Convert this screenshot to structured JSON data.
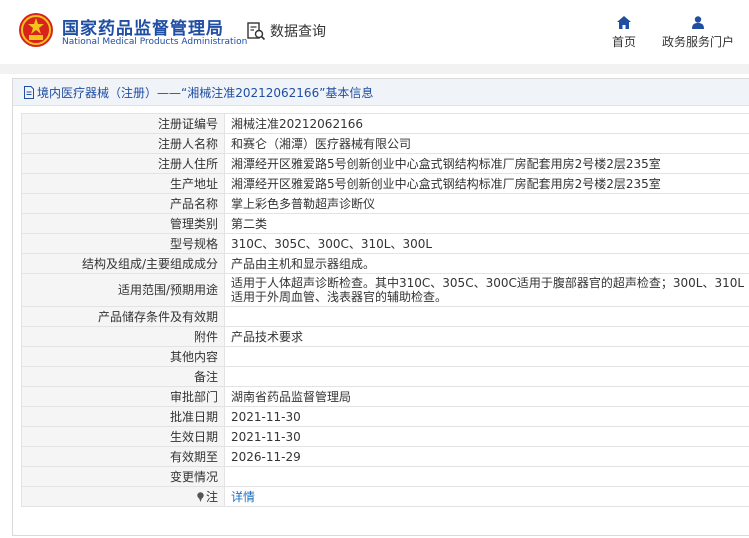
{
  "header": {
    "brand_cn": "国家药品监督管理局",
    "brand_en": "National Medical Products Administration",
    "query_label": "数据查询",
    "nav": {
      "home": "首页",
      "service": "政务服务门户"
    }
  },
  "panel": {
    "title": "境内医疗器械（注册）——“湘械注准20212062166”基本信息"
  },
  "rows": [
    {
      "label": "注册证编号",
      "value": "湘械注准20212062166"
    },
    {
      "label": "注册人名称",
      "value": "和赛仑（湘潭）医疗器械有限公司"
    },
    {
      "label": "注册人住所",
      "value": "湘潭经开区雅爱路5号创新创业中心盒式钢结构标准厂房配套用房2号楼2层235室"
    },
    {
      "label": "生产地址",
      "value": "湘潭经开区雅爱路5号创新创业中心盒式钢结构标准厂房配套用房2号楼2层235室"
    },
    {
      "label": "产品名称",
      "value": "掌上彩色多普勒超声诊断仪"
    },
    {
      "label": "管理类别",
      "value": "第二类"
    },
    {
      "label": "型号规格",
      "value": "310C、305C、300C、310L、300L"
    },
    {
      "label": "结构及组成/主要组成成分",
      "value": "产品由主机和显示器组成。"
    },
    {
      "label": "适用范围/预期用途",
      "value": "适用于人体超声诊断检查。其中310C、305C、300C适用于腹部器官的超声检查；300L、310L适用于外周血管、浅表器官的辅助检查。"
    },
    {
      "label": "产品储存条件及有效期",
      "value": ""
    },
    {
      "label": "附件",
      "value": "产品技术要求"
    },
    {
      "label": "其他内容",
      "value": ""
    },
    {
      "label": "备注",
      "value": ""
    },
    {
      "label": "审批部门",
      "value": "湖南省药品监督管理局"
    },
    {
      "label": "批准日期",
      "value": "2021-11-30"
    },
    {
      "label": "生效日期",
      "value": "2021-11-30"
    },
    {
      "label": "有效期至",
      "value": "2026-11-29"
    },
    {
      "label": "变更情况",
      "value": ""
    },
    {
      "label": "注",
      "value": "详情"
    }
  ],
  "colors": {
    "brand": "#1f4ea3",
    "logo_red": "#d7231c",
    "logo_gold": "#f4c21b",
    "link": "#1f6fbf"
  }
}
